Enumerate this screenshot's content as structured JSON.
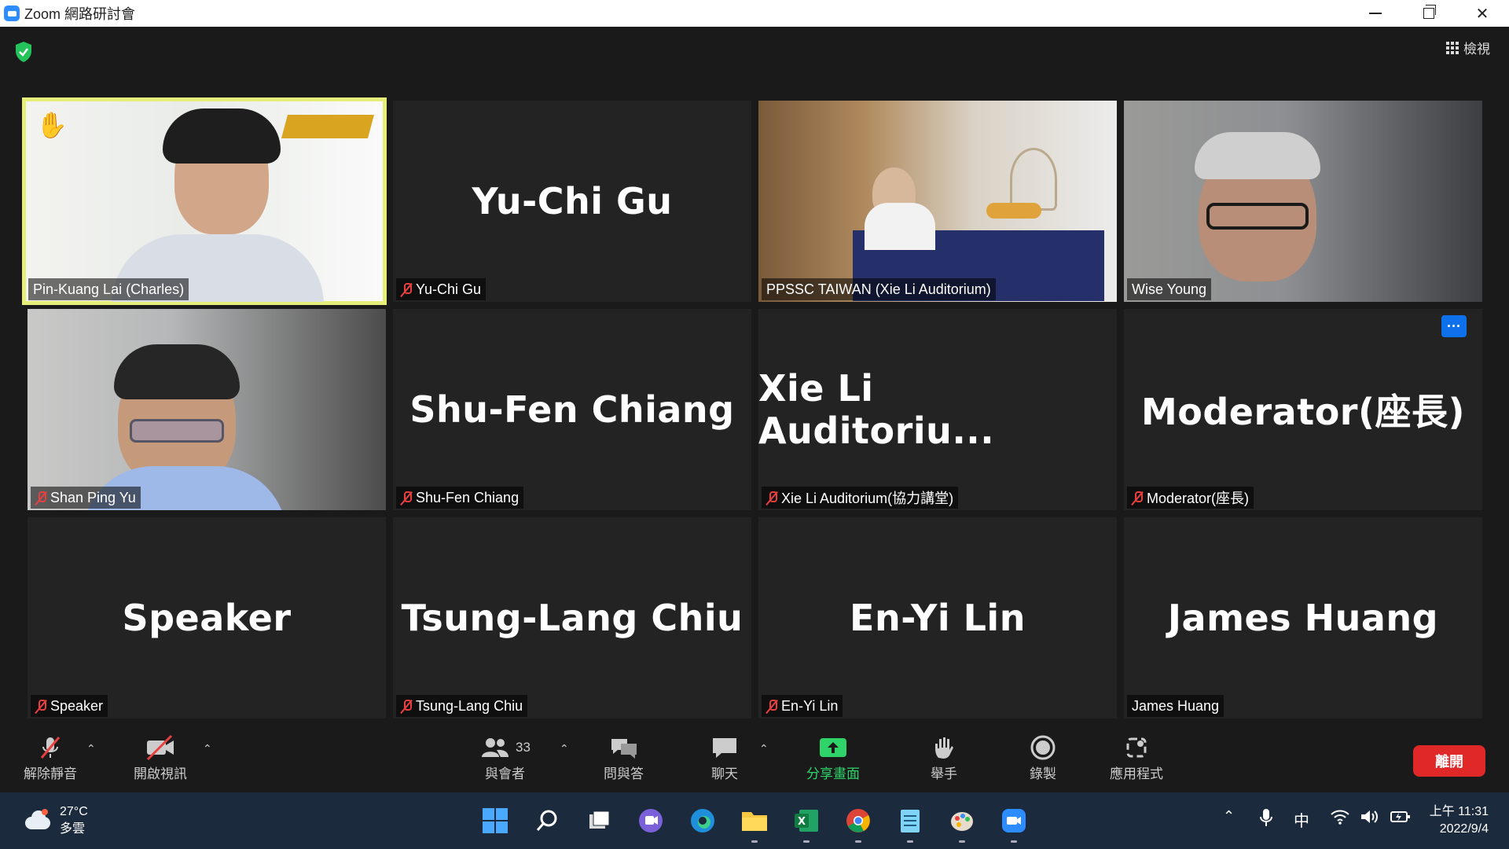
{
  "window": {
    "title": "Zoom 網路研討會"
  },
  "meeting": {
    "view_label": "檢視",
    "tiles": [
      {
        "display": "",
        "name": "Pin-Kuang Lai (Charles)",
        "muted": false,
        "video": true,
        "hand_raised": true,
        "active": true
      },
      {
        "display": "Yu-Chi Gu",
        "name": "Yu-Chi Gu",
        "muted": true,
        "video": false
      },
      {
        "display": "",
        "name": "PPSSC TAIWAN (Xie Li Auditorium)",
        "muted": false,
        "video": true
      },
      {
        "display": "",
        "name": "Wise Young",
        "muted": false,
        "video": true
      },
      {
        "display": "",
        "name": "Shan Ping Yu",
        "muted": true,
        "video": true
      },
      {
        "display": "Shu-Fen Chiang",
        "name": "Shu-Fen Chiang",
        "muted": true,
        "video": false
      },
      {
        "display": "Xie Li Auditoriu...",
        "name": "Xie Li Auditorium(協力講堂)",
        "muted": true,
        "video": false
      },
      {
        "display": "Moderator(座長)",
        "name": "Moderator(座長)",
        "muted": true,
        "video": false,
        "more_button": "···"
      },
      {
        "display": "Speaker",
        "name": "Speaker",
        "muted": true,
        "video": false
      },
      {
        "display": "Tsung-Lang Chiu",
        "name": "Tsung-Lang Chiu",
        "muted": true,
        "video": false
      },
      {
        "display": "En-Yi Lin",
        "name": "En-Yi Lin",
        "muted": true,
        "video": false
      },
      {
        "display": "James Huang",
        "name": "James Huang",
        "muted": false,
        "video": false
      }
    ]
  },
  "toolbar": {
    "unmute": "解除靜音",
    "start_video": "開啟視訊",
    "participants": "與會者",
    "participants_count": "33",
    "qa": "問與答",
    "chat": "聊天",
    "share": "分享畫面",
    "raise_hand": "舉手",
    "record": "錄製",
    "apps": "應用程式",
    "leave": "離開"
  },
  "taskbar": {
    "weather_temp": "27°C",
    "weather_desc": "多雲",
    "ime": "中",
    "time": "上午 11:31",
    "date": "2022/9/4"
  },
  "colors": {
    "accent": "#2d8cff",
    "share_green": "#2fd36a",
    "leave_red": "#e02828",
    "active_outline": "#e6ef7a",
    "mute_red": "#e84040"
  }
}
